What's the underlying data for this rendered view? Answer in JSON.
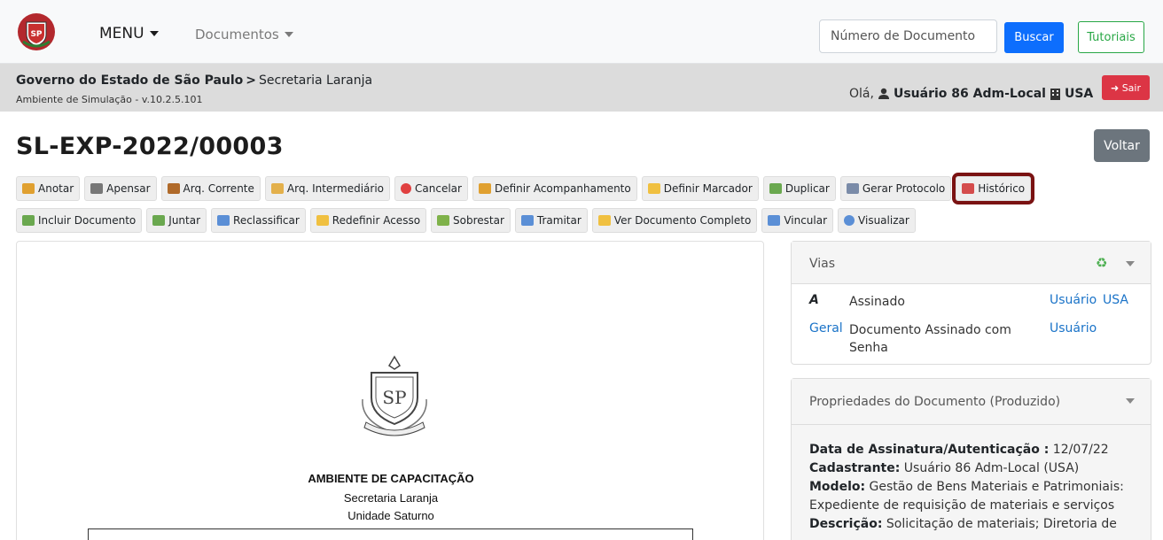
{
  "navbar": {
    "menu_label": "MENU",
    "documents_label": "Documentos",
    "search_placeholder": "Número de Documento",
    "search_button": "Buscar",
    "tutorials_button": "Tutoriais"
  },
  "breadcrumb": {
    "org": "Governo do Estado de São Paulo",
    "separator": ">",
    "unit": "Secretaria Laranja",
    "environment": "Ambiente de Simulação - v.10.2.5.101"
  },
  "user": {
    "greeting": "Olá,",
    "name": "Usuário 86 Adm-Local",
    "unit": "USA",
    "logout_label": "Sair"
  },
  "document": {
    "title": "SL-EXP-2022/00003",
    "back_label": "Voltar",
    "heading": "AMBIENTE DE CAPACITAÇÃO",
    "secretaria": "Secretaria Laranja",
    "unidade": "Unidade Saturno"
  },
  "actions_row1": [
    {
      "label": "Anotar",
      "icon": "note-icon",
      "color": "#e0a030"
    },
    {
      "label": "Apensar",
      "icon": "link-icon",
      "color": "#777777"
    },
    {
      "label": "Arq. Corrente",
      "icon": "archive-box-icon",
      "color": "#b06a2a"
    },
    {
      "label": "Arq. Intermediário",
      "icon": "archive-package-icon",
      "color": "#e3b04b"
    },
    {
      "label": "Cancelar",
      "icon": "cancel-icon",
      "color": "#e04040"
    },
    {
      "label": "Definir Acompanhamento",
      "icon": "person-doc-icon",
      "color": "#e0a030"
    },
    {
      "label": "Definir Marcador",
      "icon": "folder-star-icon",
      "color": "#f0c040"
    },
    {
      "label": "Duplicar",
      "icon": "duplicate-icon",
      "color": "#6aa84f"
    },
    {
      "label": "Gerar Protocolo",
      "icon": "printer-icon",
      "color": "#7a8ba8"
    },
    {
      "label": "Histórico",
      "icon": "calendar-icon",
      "color": "#d44c4c"
    }
  ],
  "actions_row2": [
    {
      "label": "Incluir Documento",
      "icon": "add-document-icon",
      "color": "#6aa84f"
    },
    {
      "label": "Juntar",
      "icon": "join-icon",
      "color": "#6aa84f"
    },
    {
      "label": "Reclassificar",
      "icon": "reclassify-icon",
      "color": "#5b8fd6"
    },
    {
      "label": "Redefinir Acesso",
      "icon": "shield-icon",
      "color": "#f0c040"
    },
    {
      "label": "Sobrestar",
      "icon": "sobrestar-icon",
      "color": "#7fb24a"
    },
    {
      "label": "Tramitar",
      "icon": "send-icon",
      "color": "#5b8fd6"
    },
    {
      "label": "Ver Documento Completo",
      "icon": "folder-icon",
      "color": "#f0c040"
    },
    {
      "label": "Vincular",
      "icon": "book-icon",
      "color": "#5b8fd6"
    },
    {
      "label": "Visualizar",
      "icon": "eye-icon",
      "color": "#5b8fd6"
    }
  ],
  "vias": {
    "title": "Vias",
    "rows": [
      {
        "code": "A",
        "description": "Assinado",
        "user": "Usuário",
        "unit": "USA"
      },
      {
        "code": "Geral",
        "description": "Documento Assinado com Senha",
        "user": "Usuário",
        "unit": ""
      }
    ]
  },
  "properties": {
    "title": "Propriedades do Documento (Produzido)",
    "items": [
      {
        "label": "Data de Assinatura/Autenticação :",
        "value": "12/07/22"
      },
      {
        "label": "Cadastrante:",
        "value": "Usuário 86 Adm-Local (USA)"
      },
      {
        "label": "Modelo:",
        "value": "Gestão de Bens Materiais e Patrimoniais: Expediente de requisição de materiais e serviços"
      },
      {
        "label": "Descrição:",
        "value": "Solicitação de materiais; Diretoria de"
      }
    ]
  },
  "colors": {
    "primary": "#0d6efd",
    "success": "#28a745",
    "danger": "#dc3545",
    "highlight_border": "#7a1212",
    "link": "#1a73c8"
  }
}
